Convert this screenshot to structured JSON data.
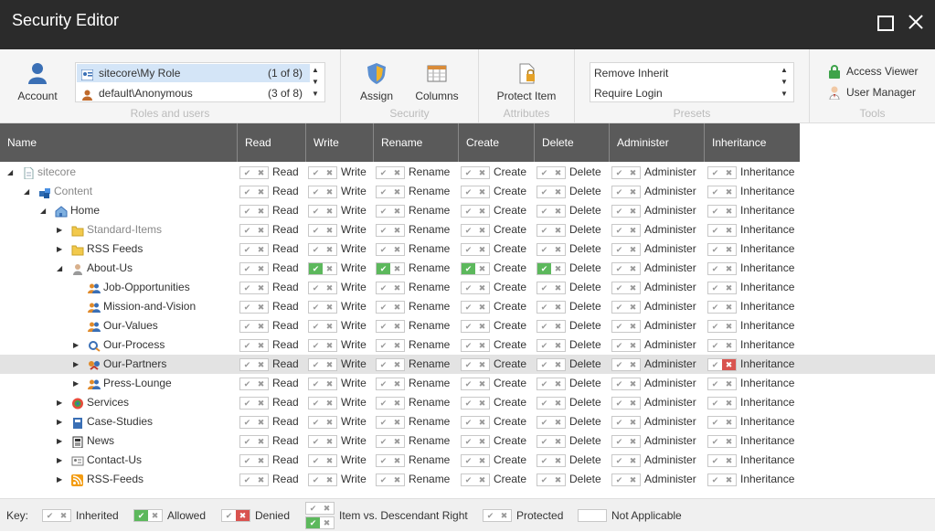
{
  "window": {
    "title": "Security Editor"
  },
  "ribbon": {
    "account_label": "Account",
    "roles_group_label": "Roles and users",
    "roles": [
      {
        "name": "sitecore\\My Role",
        "count": "(1 of 8)"
      },
      {
        "name": "default\\Anonymous",
        "count": "(3 of 8)"
      }
    ],
    "security_group_label": "Security",
    "assign_label": "Assign",
    "columns_label": "Columns",
    "attributes_group_label": "Attributes",
    "protect_label": "Protect Item",
    "presets_group_label": "Presets",
    "presets": [
      "Remove Inherit",
      "Require Login"
    ],
    "tools_group_label": "Tools",
    "access_viewer_label": "Access Viewer",
    "user_manager_label": "User Manager"
  },
  "columns": [
    "Name",
    "Read",
    "Write",
    "Rename",
    "Create",
    "Delete",
    "Administer",
    "Inheritance"
  ],
  "rows": [
    {
      "name": "sitecore",
      "expander": "▲",
      "icon": "document-icon",
      "grey": true,
      "allowed": [],
      "denied": []
    },
    {
      "name": "Content",
      "expander": "▲",
      "icon": "content-icon",
      "grey": true,
      "allowed": [],
      "denied": []
    },
    {
      "name": "Home",
      "expander": "▲",
      "icon": "home-icon",
      "grey": false,
      "allowed": [],
      "denied": []
    },
    {
      "name": "Standard-Items",
      "expander": "▶",
      "icon": "folder-icon",
      "grey": true,
      "allowed": [],
      "denied": []
    },
    {
      "name": "RSS Feeds",
      "expander": "▶",
      "icon": "folder-icon",
      "grey": false,
      "allowed": [],
      "denied": []
    },
    {
      "name": "About-Us",
      "expander": "▲",
      "icon": "person-icon",
      "grey": false,
      "allowed": [
        "write",
        "rename",
        "create",
        "delete"
      ],
      "denied": []
    },
    {
      "name": "Job-Opportunities",
      "expander": "",
      "icon": "group-icon",
      "grey": false,
      "allowed": [],
      "denied": []
    },
    {
      "name": "Mission-and-Vision",
      "expander": "",
      "icon": "group-icon",
      "grey": false,
      "allowed": [],
      "denied": []
    },
    {
      "name": "Our-Values",
      "expander": "",
      "icon": "group-icon",
      "grey": false,
      "allowed": [],
      "denied": []
    },
    {
      "name": "Our-Process",
      "expander": "▶",
      "icon": "process-icon",
      "grey": false,
      "allowed": [],
      "denied": []
    },
    {
      "name": "Our-Partners",
      "expander": "▶",
      "icon": "partners-icon",
      "grey": false,
      "allowed": [],
      "denied": [
        "inheritance"
      ],
      "selected": true
    },
    {
      "name": "Press-Lounge",
      "expander": "▶",
      "icon": "group-icon",
      "grey": false,
      "allowed": [],
      "denied": []
    },
    {
      "name": "Services",
      "expander": "▶",
      "icon": "services-icon",
      "grey": false,
      "allowed": [],
      "denied": []
    },
    {
      "name": "Case-Studies",
      "expander": "▶",
      "icon": "book-icon",
      "grey": false,
      "allowed": [],
      "denied": []
    },
    {
      "name": "News",
      "expander": "▶",
      "icon": "news-icon",
      "grey": false,
      "allowed": [],
      "denied": []
    },
    {
      "name": "Contact-Us",
      "expander": "▶",
      "icon": "contact-icon",
      "grey": false,
      "allowed": [],
      "denied": []
    },
    {
      "name": "RSS-Feeds",
      "expander": "▶",
      "icon": "rss-icon",
      "grey": false,
      "allowed": [],
      "denied": []
    }
  ],
  "key": {
    "title": "Key:",
    "inherited": "Inherited",
    "allowed": "Allowed",
    "denied": "Denied",
    "item_vs_descendant": "Item vs. Descendant Right",
    "protected": "Protected",
    "not_applicable": "Not Applicable"
  },
  "colors": {
    "allow": "#5cb85c",
    "deny": "#d9534f",
    "titlebar": "#2b2b2b",
    "header": "#5a5a5a"
  }
}
